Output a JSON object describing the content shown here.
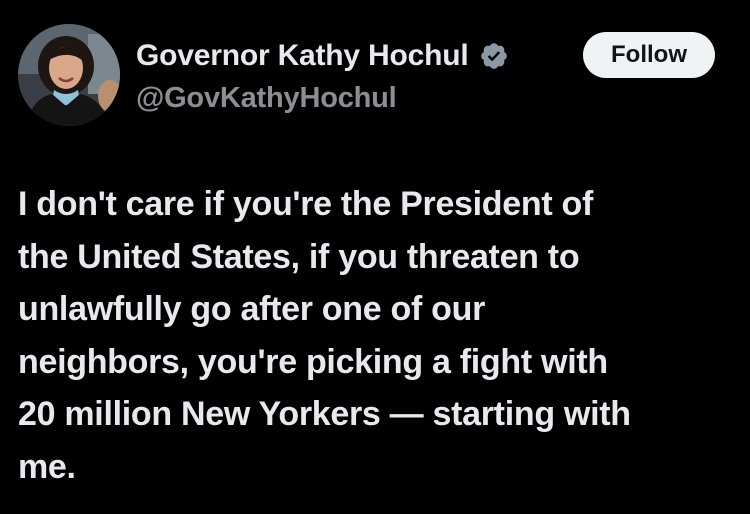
{
  "author": {
    "display_name": "Governor Kathy Hochul",
    "handle": "@GovKathyHochul",
    "verified_icon": "verified-badge-icon",
    "verified_color": "#8b98a5"
  },
  "follow_button": {
    "label": "Follow"
  },
  "tweet": {
    "text": "I don't care if you're the President of\nthe United States, if you threaten to\nunlawfully go after one of our\nneighbors, you're picking a fight with\n20 million New Yorkers — starting with\nme."
  },
  "colors": {
    "background": "#000000",
    "text": "#e7e9ea",
    "secondary_text": "#8b8f94",
    "button_bg": "#eff3f4"
  }
}
